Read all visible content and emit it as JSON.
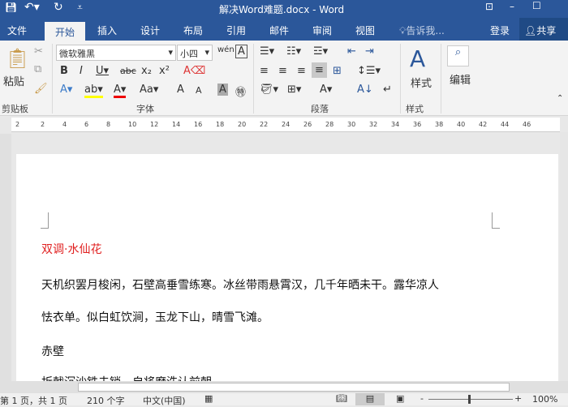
{
  "titlebar": {
    "title": "解决Word难题.docx - Word"
  },
  "tabs": [
    "文件",
    "开始",
    "插入",
    "设计",
    "布局",
    "引用",
    "邮件",
    "审阅",
    "视图"
  ],
  "tell_me": "告诉我...",
  "login": "登录",
  "share": "共享",
  "ribbon": {
    "font_name": "微软雅黑",
    "font_size": "小四",
    "paste": "粘贴",
    "styles": "样式",
    "edit": "编辑",
    "groups": [
      "剪贴板",
      "字体",
      "段落",
      "样式"
    ]
  },
  "ruler_ticks": [
    "2",
    "2",
    "4",
    "6",
    "8",
    "10",
    "12",
    "14",
    "16",
    "18",
    "20",
    "22",
    "24",
    "26",
    "28",
    "30",
    "32",
    "34",
    "36",
    "38",
    "40",
    "42",
    "44",
    "46"
  ],
  "document": {
    "lines": [
      {
        "text": "双调·水仙花",
        "color": "#e02020"
      },
      {
        "text": "天机织罢月梭闲，石壁高垂雪练寒。冰丝带雨悬霄汉，几千年晒未干。露华凉人",
        "color": "#111"
      },
      {
        "text": "怯衣单。似白虹饮涧，玉龙下山，晴雪飞滩。",
        "color": "#111"
      },
      {
        "text": "赤壁",
        "color": "#111"
      },
      {
        "text": "折戟沉沙铁未销，自将磨洗认前朝",
        "color": "#111"
      }
    ]
  },
  "status": {
    "page": "第 1 页，共 1 页",
    "words": "210 个字",
    "lang": "中文(中国)",
    "zoom": "100%"
  }
}
